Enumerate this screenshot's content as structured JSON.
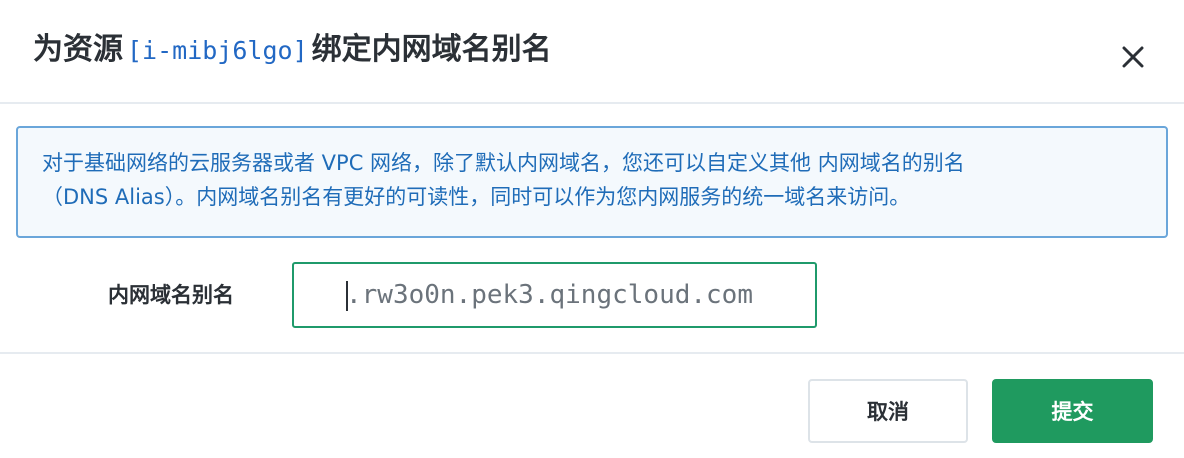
{
  "dialog": {
    "title_prefix": "为资源",
    "resource_id": "[i-mibj6lgo]",
    "title_suffix": "绑定内网域名别名",
    "close_icon": "close-icon"
  },
  "notice": {
    "line1": "对于基础网络的云服务器或者 VPC 网络，除了默认内网域名，您还可以自定义其他 内网域名的别名",
    "line2": "（DNS Alias）。内网域名别名有更好的可读性，同时可以作为您内网服务的统一域名来访问。"
  },
  "form": {
    "alias_label": "内网域名别名",
    "alias_placeholder": ".rw3o0n.pek3.qingcloud.com"
  },
  "footer": {
    "cancel_label": "取消",
    "submit_label": "提交"
  },
  "colors": {
    "accent": "#1f9a5f",
    "notice_border": "#6aa6da",
    "notice_text": "#1f6cb8"
  }
}
